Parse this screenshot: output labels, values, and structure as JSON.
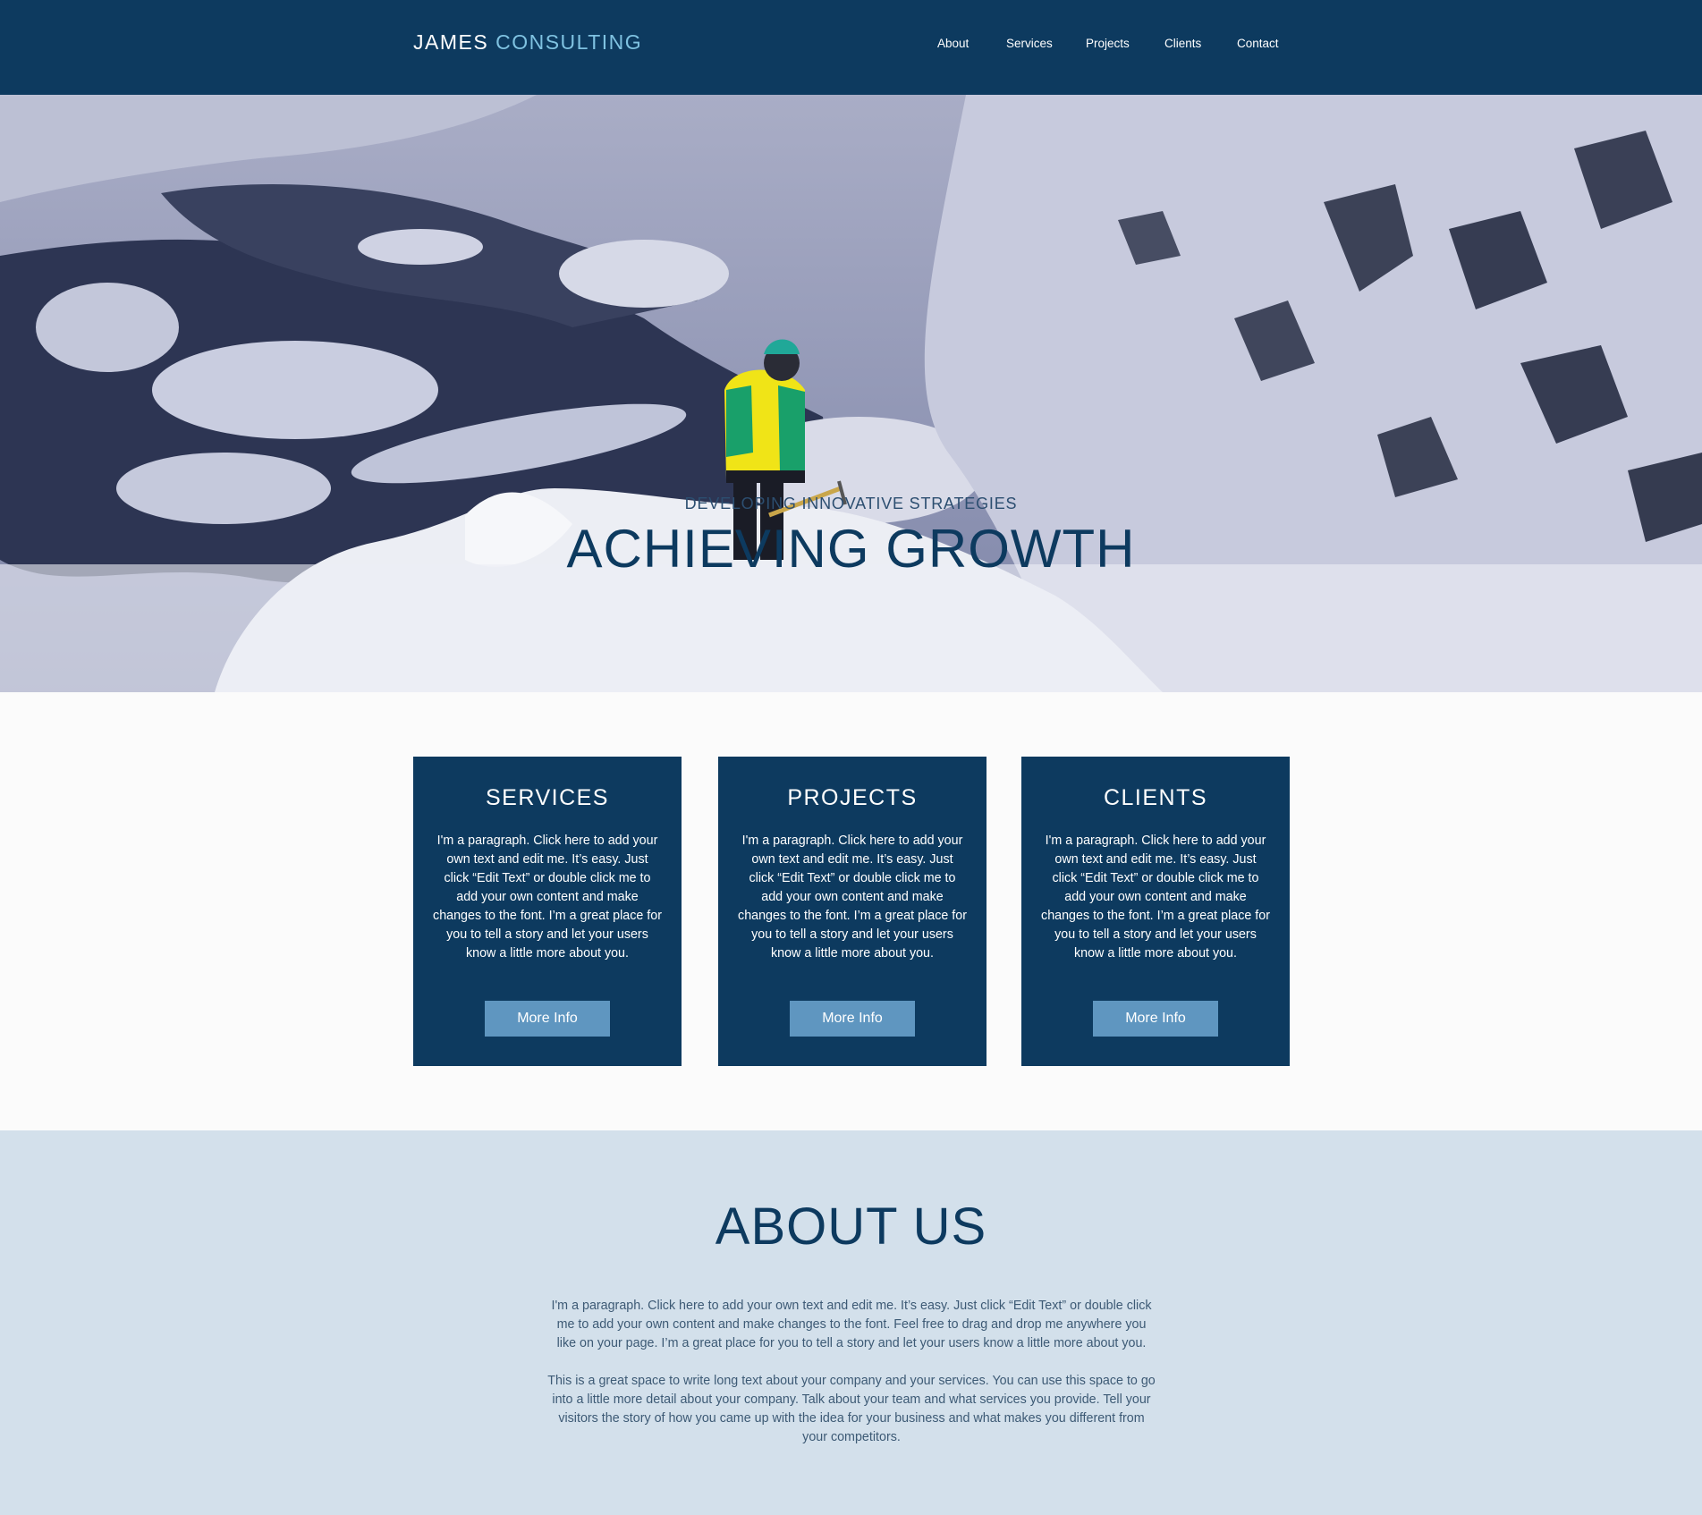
{
  "header": {
    "logo_first": "JAMES",
    "logo_second": "CONSULTING",
    "nav": [
      "About",
      "Services",
      "Projects",
      "Clients",
      "Contact"
    ]
  },
  "hero": {
    "subtitle": "DEVELOPING INNOVATIVE STRATEGIES",
    "title": "ACHIEVING GROWTH"
  },
  "cards": [
    {
      "title": "SERVICES",
      "text": "I'm a paragraph. Click here to add your own text and edit me. It’s easy. Just click “Edit Text” or double click me to add your own content and make changes to the font. I’m a great place for you to tell a story and let your users know a little more about you.",
      "button": "More Info"
    },
    {
      "title": "PROJECTS",
      "text": "I'm a paragraph. Click here to add your own text and edit me. It’s easy. Just click “Edit Text” or double click me to add your own content and make changes to the font. I’m a great place for you to tell a story and let your users know a little more about you.",
      "button": "More Info"
    },
    {
      "title": "CLIENTS",
      "text": "I'm a paragraph. Click here to add your own text and edit me. It’s easy. Just click “Edit Text” or double click me to add your own content and make changes to the font. I’m a great place for you to tell a story and let your users know a little more about you.",
      "button": "More Info"
    }
  ],
  "about": {
    "title": "ABOUT US",
    "p1": "I'm a paragraph. Click here to add your own text and edit me. It’s easy. Just click “Edit Text” or double click me to add your own content and make changes to the font. Feel free to drag and drop me anywhere you like on your page. I’m a great place for you to tell a story and let your users know a little more about you.",
    "p2": "This is a great space to write long text about your company and your services. You can use this space to go into a little more detail about your company. Talk about your team and what services you provide. Tell your visitors the story of how you came up with the idea for your business and what makes you different from your competitors."
  },
  "colors": {
    "header_bg": "#0d3a5f",
    "logo_accent": "#7fc2e1",
    "button_bg": "#5f96c0",
    "about_bg": "#d3e0eb"
  }
}
